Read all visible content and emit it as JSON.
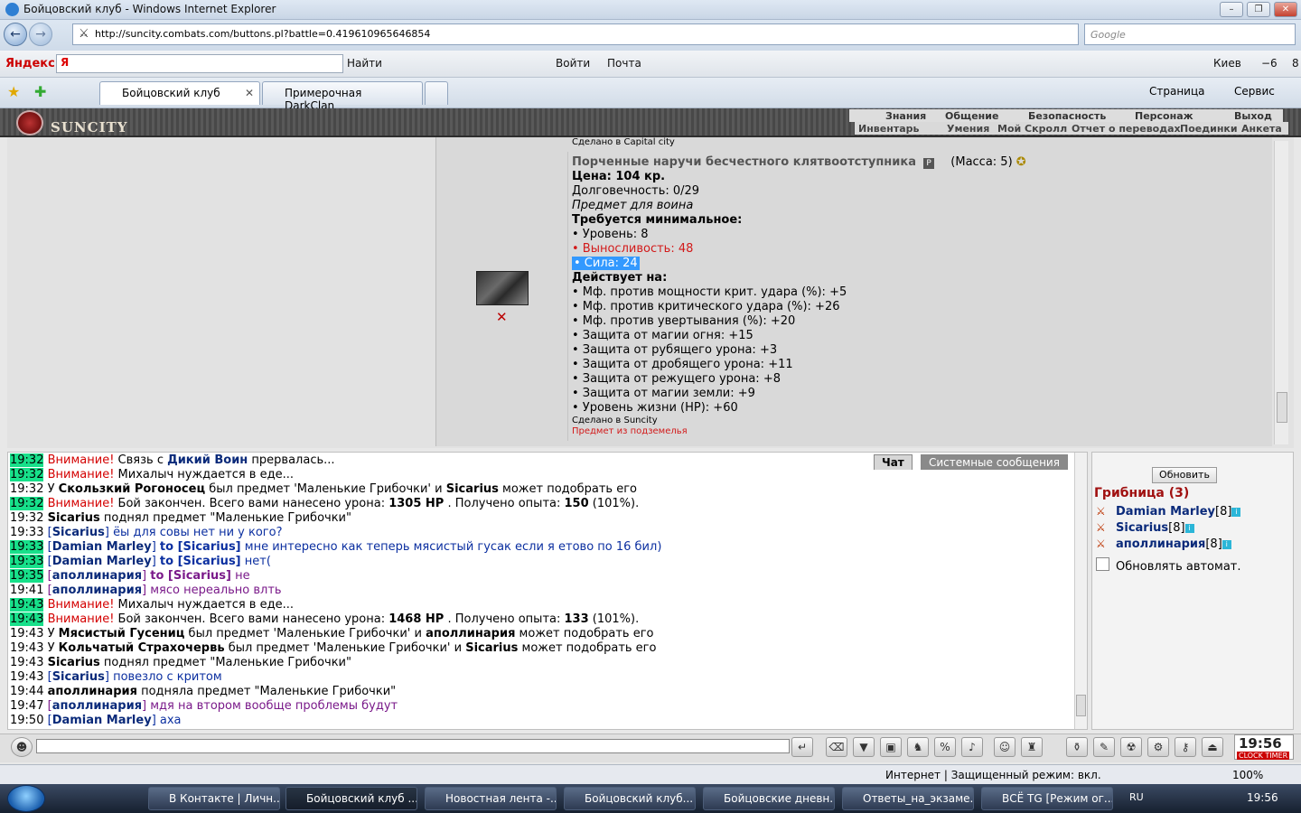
{
  "window": {
    "title": "Бойцовский клуб - Windows Internet Explorer"
  },
  "address": {
    "url": "http://suncity.combats.com/buttons.pl?battle=0.419610965646854",
    "search_placeholder": "Google"
  },
  "yandex_bar": {
    "brand": "Яндекс",
    "input": "Я",
    "find": "Найти",
    "login": "Войти",
    "mail": "Почта",
    "city": "Киев",
    "temp": "−6",
    "count": "8"
  },
  "tabs": [
    {
      "label": "Бойцовский клуб"
    },
    {
      "label": "Примерочная DarkClan"
    }
  ],
  "ie_toolbar": {
    "page": "Страница",
    "tools": "Сервис"
  },
  "game_header": {
    "logo": "SUNCITY",
    "menu1": [
      "Знания",
      "Общение",
      "Безопасность",
      "Персонаж",
      "Выход"
    ],
    "menu2": [
      "Инвентарь",
      "Умения",
      "Мой Скролл",
      "Отчет о переводах",
      "Поединки",
      "Анкета"
    ]
  },
  "item": {
    "made_in_prev": "Сделано в Capital city",
    "name": "Порченные наручи бесчестного клятвоотступника",
    "mass": "(Масса: 5)",
    "price": "Цена: 104 кр.",
    "durability": "Долговечность: 0/29",
    "for_class": "Предмет для воина",
    "req_title": "Требуется минимальное:",
    "req_level": "• Уровень: 8",
    "req_endurance": "• Выносливость: 48",
    "req_strength": "• Сила: 24",
    "acts_title": "Действует на:",
    "mods": [
      "• Мф. против мощности крит. удара (%): +5",
      "• Мф. против критического удара (%): +26",
      "• Мф. против увертывания (%): +20",
      "• Защита от магии огня: +15",
      "• Защита от рубящего урона: +3",
      "• Защита от дробящего урона: +11",
      "• Защита от режущего урона: +8",
      "• Защита от магии земли: +9",
      "• Уровень жизни (HP): +60"
    ],
    "made_in": "Сделано в Suncity",
    "dungeon": "Предмет из подземелья"
  },
  "chat_tabs": [
    "Чат",
    "Системные сообщения"
  ],
  "chat": [
    {
      "t": "19:32",
      "g": true,
      "parts": [
        [
          "w",
          "Внимание!"
        ],
        [
          "",
          " Связь с "
        ],
        [
          "n",
          "Дикий Воин"
        ],
        [
          "",
          " прервалась..."
        ]
      ]
    },
    {
      "t": "19:32",
      "g": true,
      "parts": [
        [
          "w",
          "Внимание!"
        ],
        [
          "",
          " Михалыч нуждается в еде..."
        ]
      ]
    },
    {
      "t": "19:32",
      "g": false,
      "parts": [
        [
          "",
          "У "
        ],
        [
          "k",
          "Скользкий Рогоносец"
        ],
        [
          "",
          " был предмет 'Маленькие Грибочки' и "
        ],
        [
          "k",
          "Sicarius"
        ],
        [
          "",
          " может подобрать его"
        ]
      ]
    },
    {
      "t": "19:32",
      "g": true,
      "parts": [
        [
          "w",
          "Внимание!"
        ],
        [
          "",
          " Бой закончен. Всего вами нанесено урона: "
        ],
        [
          "k",
          "1305 HP"
        ],
        [
          "",
          " . Получено опыта: "
        ],
        [
          "k",
          "150"
        ],
        [
          "",
          " (101%)."
        ]
      ]
    },
    {
      "t": "19:32",
      "g": false,
      "parts": [
        [
          "k",
          "Sicarius"
        ],
        [
          "",
          " поднял предмет \"Маленькие Грибочки\""
        ]
      ]
    },
    {
      "t": "19:33",
      "g": false,
      "parts": [
        [
          "b",
          "["
        ],
        [
          "n",
          "Sicarius"
        ],
        [
          "b",
          "] ёы для совы нет ни у кого?"
        ]
      ]
    },
    {
      "t": "19:33",
      "g": true,
      "parts": [
        [
          "b",
          "["
        ],
        [
          "n",
          "Damian Marley"
        ],
        [
          "b",
          "] "
        ],
        [
          "bt",
          "to [Sicarius]"
        ],
        [
          "b",
          " мне интересно как теперь мясистый гусак если я етово по 16 бил)"
        ]
      ]
    },
    {
      "t": "19:33",
      "g": true,
      "parts": [
        [
          "b",
          "["
        ],
        [
          "n",
          "Damian Marley"
        ],
        [
          "b",
          "] "
        ],
        [
          "bt",
          "to [Sicarius]"
        ],
        [
          "b",
          " нет("
        ]
      ]
    },
    {
      "t": "19:35",
      "g": true,
      "parts": [
        [
          "p",
          "["
        ],
        [
          "n",
          "аполлинария"
        ],
        [
          "p",
          "] "
        ],
        [
          "pt",
          "to [Sicarius]"
        ],
        [
          "p",
          " не"
        ]
      ]
    },
    {
      "t": "19:41",
      "g": false,
      "parts": [
        [
          "p",
          "["
        ],
        [
          "n",
          "аполлинария"
        ],
        [
          "p",
          "] мясо нереально влть"
        ]
      ]
    },
    {
      "t": "19:43",
      "g": true,
      "parts": [
        [
          "w",
          "Внимание!"
        ],
        [
          "",
          " Михалыч нуждается в еде..."
        ]
      ]
    },
    {
      "t": "19:43",
      "g": true,
      "parts": [
        [
          "w",
          "Внимание!"
        ],
        [
          "",
          " Бой закончен. Всего вами нанесено урона: "
        ],
        [
          "k",
          "1468 HP"
        ],
        [
          "",
          " . Получено опыта: "
        ],
        [
          "k",
          "133"
        ],
        [
          "",
          " (101%)."
        ]
      ]
    },
    {
      "t": "19:43",
      "g": false,
      "parts": [
        [
          "",
          "У "
        ],
        [
          "k",
          "Мясистый Гусениц"
        ],
        [
          "",
          " был предмет 'Маленькие Грибочки' и "
        ],
        [
          "k",
          "аполлинария"
        ],
        [
          "",
          " может подобрать его"
        ]
      ]
    },
    {
      "t": "19:43",
      "g": false,
      "parts": [
        [
          "",
          "У "
        ],
        [
          "k",
          "Кольчатый Страхочервь"
        ],
        [
          "",
          " был предмет 'Маленькие Грибочки' и "
        ],
        [
          "k",
          "Sicarius"
        ],
        [
          "",
          " может подобрать его"
        ]
      ]
    },
    {
      "t": "19:43",
      "g": false,
      "parts": [
        [
          "k",
          "Sicarius"
        ],
        [
          "",
          " поднял предмет \"Маленькие Грибочки\""
        ]
      ]
    },
    {
      "t": "19:43",
      "g": false,
      "parts": [
        [
          "b",
          "["
        ],
        [
          "n",
          "Sicarius"
        ],
        [
          "b",
          "] повезло с критом"
        ]
      ]
    },
    {
      "t": "19:44",
      "g": false,
      "parts": [
        [
          "k",
          "аполлинария"
        ],
        [
          "",
          " подняла предмет \"Маленькие Грибочки\""
        ]
      ]
    },
    {
      "t": "19:47",
      "g": false,
      "parts": [
        [
          "p",
          "["
        ],
        [
          "n",
          "аполлинария"
        ],
        [
          "p",
          "] мдя на втором вообще проблемы будут"
        ]
      ]
    },
    {
      "t": "19:50",
      "g": false,
      "parts": [
        [
          "b",
          "["
        ],
        [
          "n",
          "Damian Marley"
        ],
        [
          "b",
          "] аха"
        ]
      ]
    }
  ],
  "right_panel": {
    "refresh": "Обновить",
    "location": "Грибница (3)",
    "users": [
      {
        "name": "Damian Marley",
        "level": "[8]"
      },
      {
        "name": "Sicarius",
        "level": "[8]"
      },
      {
        "name": "аполлинария",
        "level": "[8]"
      }
    ],
    "auto_refresh": "Обновлять автомат."
  },
  "clock": {
    "time": "19:56",
    "label": "CLOCK TIMER"
  },
  "statusbar": {
    "zone": "Интернет | Защищенный режим: вкл.",
    "zoom": "100%"
  },
  "taskbar": {
    "tasks": [
      "В Контакте | Личн...",
      "Бойцовский клуб ...",
      "Новостная лента -...",
      "Бойцовский клуб...",
      "Бойцовские дневн...",
      "Ответы_на_экзаме...",
      "ВСЁ TG [Режим ог..."
    ],
    "lang": "RU",
    "time": "19:56"
  }
}
